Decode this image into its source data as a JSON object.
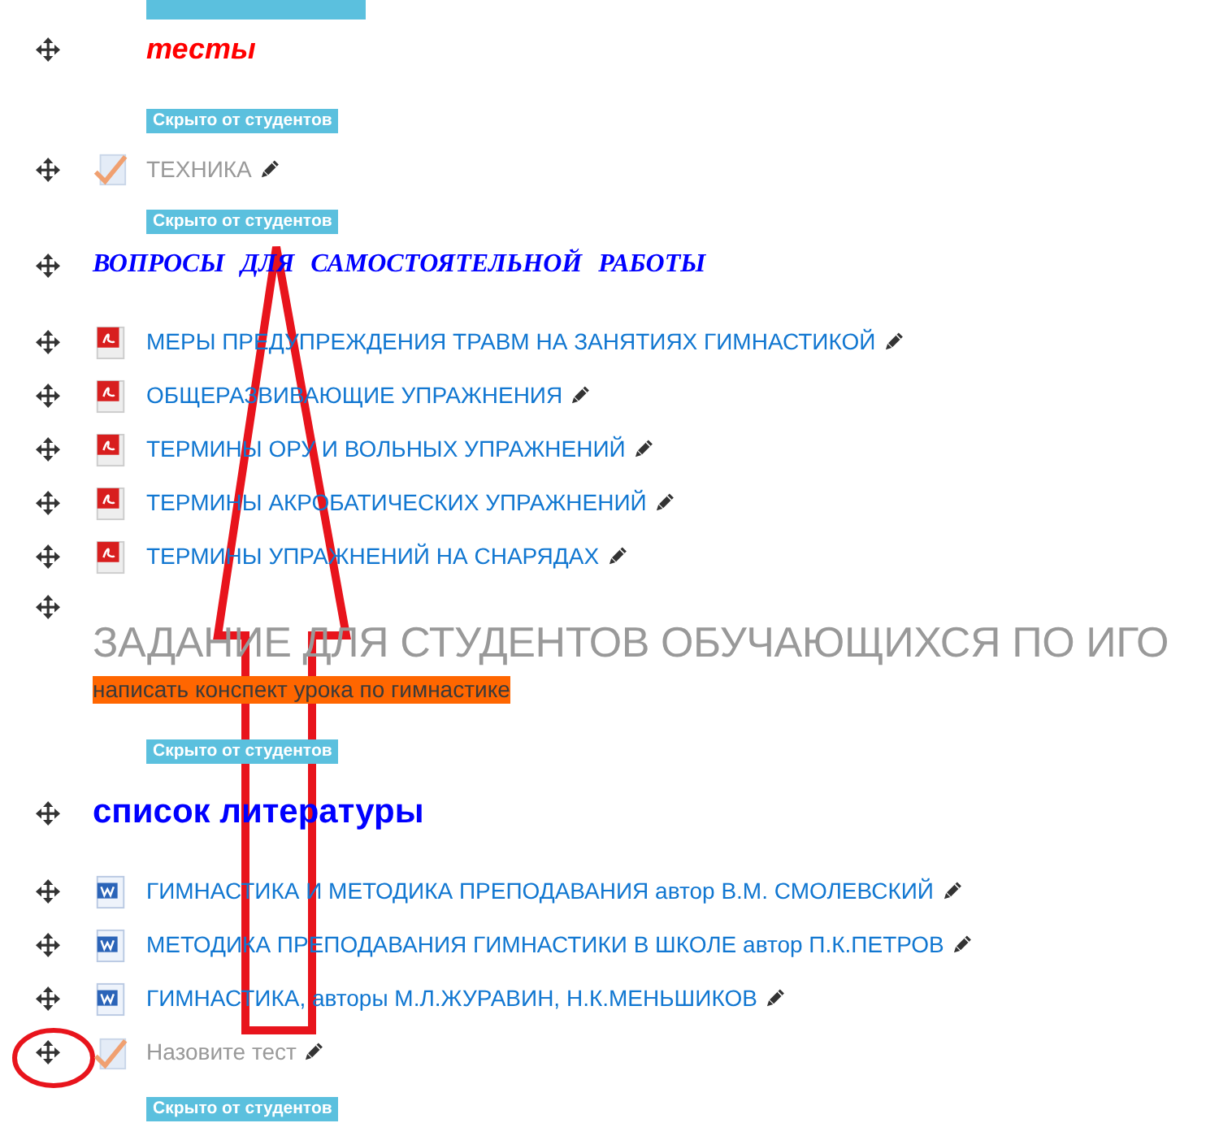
{
  "items": [
    {
      "kind": "cut_badge"
    },
    {
      "kind": "caption",
      "text": "тесты"
    },
    {
      "kind": "badge",
      "text": "Скрыто от студентов"
    },
    {
      "kind": "quiz",
      "text": "ТЕХНИКА",
      "hidden": true
    },
    {
      "kind": "badge",
      "text": "Скрыто от студентов"
    },
    {
      "kind": "heading",
      "text": "ВОПРОСЫ ДЛЯ САМОСТОЯТЕЛЬНОЙ РАБОТЫ"
    },
    {
      "kind": "pdf",
      "text": "МЕРЫ ПРЕДУПРЕЖДЕНИЯ ТРАВМ НА ЗАНЯТИЯХ ГИМНАСТИКОЙ",
      "hidden": false
    },
    {
      "kind": "pdf",
      "text": "ОБЩЕРАЗВИВАЮЩИЕ УПРАЖНЕНИЯ",
      "hidden": false
    },
    {
      "kind": "pdf",
      "text": "ТЕРМИНЫ ОРУ И ВОЛЬНЫХ УПРАЖНЕНИЙ",
      "hidden": false
    },
    {
      "kind": "pdf",
      "text": "ТЕРМИНЫ АКРОБАТИЧЕСКИХ УПРАЖНЕНИЙ",
      "hidden": false
    },
    {
      "kind": "pdf",
      "text": "ТЕРМИНЫ УПРАЖНЕНИЙ НА СНАРЯДАХ",
      "hidden": false
    },
    {
      "kind": "task",
      "title": "ЗАДАНИЕ ДЛЯ СТУДЕНТОВ ОБУЧАЮЩИХСЯ ПО ИГО",
      "description": "написать конспект урока по гимнастике"
    },
    {
      "kind": "badge",
      "text": "Скрыто от студентов"
    },
    {
      "kind": "subheading",
      "text": "список литературы"
    },
    {
      "kind": "document",
      "text": "ГИМНАСТИКА И МЕТОДИКА ПРЕПОДАВАНИЯ автор В.М. СМОЛЕВСКИЙ",
      "hidden": false
    },
    {
      "kind": "document",
      "text": "МЕТОДИКА ПРЕПОДАВАНИЯ ГИМНАСТИКИ В ШКОЛЕ автор П.К.ПЕТРОВ",
      "hidden": false
    },
    {
      "kind": "document",
      "text": "ГИМНАСТИКА, авторы М.Л.ЖУРАВИН, Н.К.МЕНЬШИКОВ",
      "hidden": false
    },
    {
      "kind": "quiz",
      "text": "Назовите тест",
      "hidden": true
    },
    {
      "kind": "badge",
      "text": "Скрыто от студентов"
    }
  ],
  "annotations": [
    {
      "kind": "arrow"
    },
    {
      "kind": "circle"
    }
  ]
}
